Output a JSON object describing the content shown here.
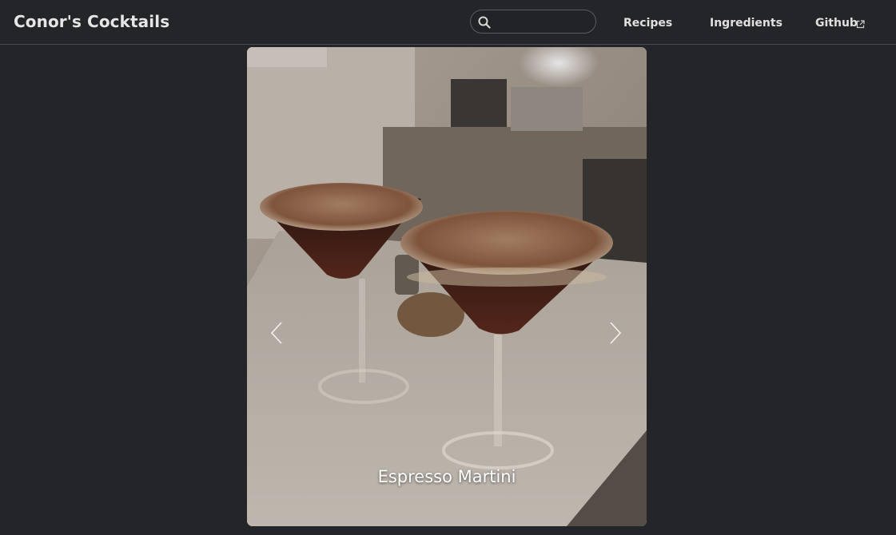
{
  "header": {
    "brand": "Conor's Cocktails",
    "search": {
      "value": "",
      "placeholder": ""
    },
    "nav": {
      "recipes": "Recipes",
      "ingredients": "Ingredients",
      "github": "Github"
    }
  },
  "carousel": {
    "caption": "Espresso Martini",
    "image_subject": "two espresso martinis on a kitchen counter"
  },
  "colors": {
    "background": "#242529",
    "text": "#e6e6e6",
    "border": "#4a4c52"
  },
  "icons": [
    "search-icon",
    "external-link-icon",
    "chevron-left-icon",
    "chevron-right-icon"
  ]
}
